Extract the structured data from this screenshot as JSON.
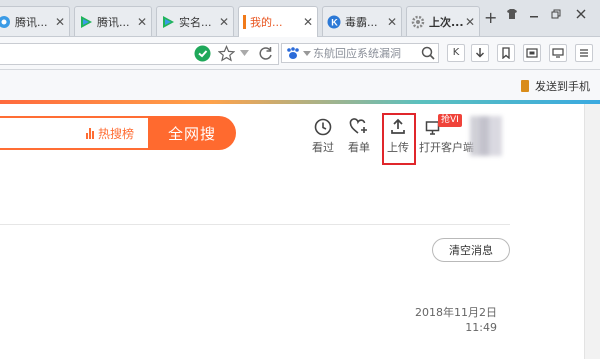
{
  "tabs": [
    {
      "title": "腾讯...",
      "icon": "qq-video-icon"
    },
    {
      "title": "腾讯...",
      "icon": "tencent-video-icon"
    },
    {
      "title": "实名...",
      "icon": "tencent-video-icon"
    },
    {
      "title": "我的...",
      "icon": "orange-bar-icon"
    },
    {
      "title": "毒霸...",
      "icon": "kingsoft-k-icon"
    },
    {
      "title": "上次...",
      "icon": "gear-icon"
    }
  ],
  "tab_close": "✕",
  "newtab_label": "+",
  "toolbar": {
    "search_placeholder": "东航回应系统漏洞",
    "btn_k": "K",
    "btn_down": "↓",
    "btn_bookmark": "⎘"
  },
  "bar2": {
    "send_to_phone": "发送到手机"
  },
  "page": {
    "hot_label": "热搜榜",
    "search_button": "全网搜",
    "header_icons": [
      {
        "label": "看过",
        "icon": "clock-icon"
      },
      {
        "label": "看单",
        "icon": "heart-plus-icon"
      },
      {
        "label": "上传",
        "icon": "upload-icon"
      },
      {
        "label": "打开客户端",
        "icon": "monitor-icon"
      }
    ],
    "vip_badge": "抢VI",
    "clear_messages": "清空消息",
    "message_date": "2018年11月2日",
    "message_time": "11:49"
  },
  "colors": {
    "accent": "#ff6a2f",
    "highlight": "#e0262b"
  }
}
